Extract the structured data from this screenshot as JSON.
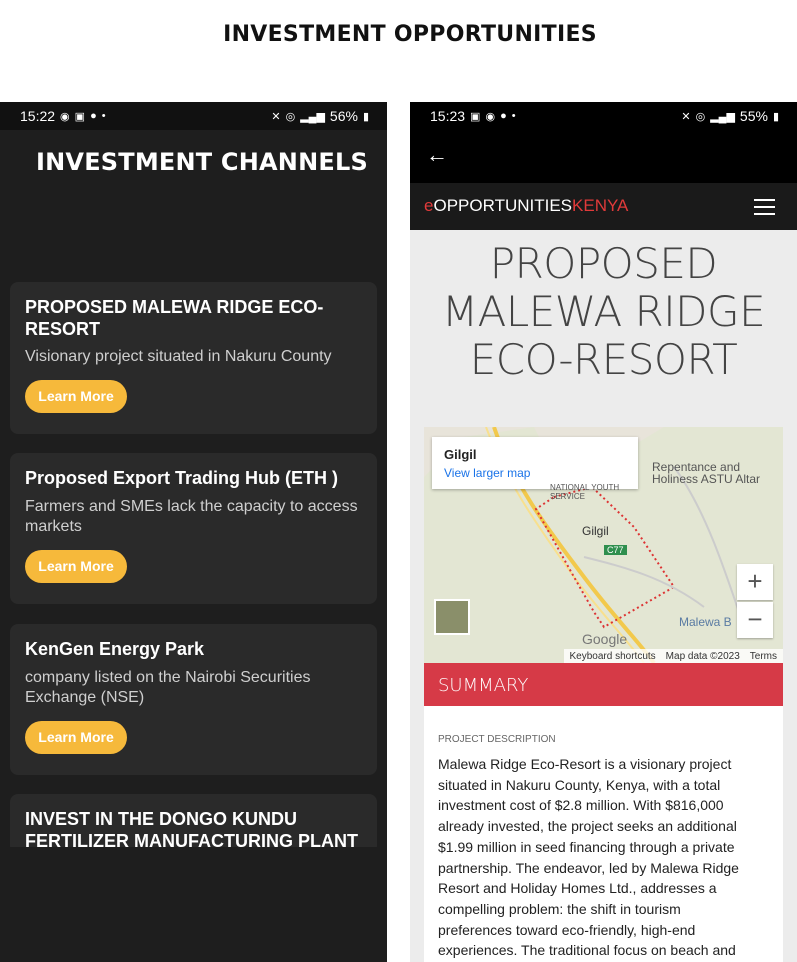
{
  "heading": "INVESTMENT OPPORTUNITIES",
  "left_phone": {
    "status": {
      "time": "15:22",
      "battery": "56%"
    },
    "title": "INVESTMENT CHANNELS",
    "cards": [
      {
        "title": "PROPOSED MALEWA RIDGE ECO-RESORT",
        "desc": "Visionary project situated in Nakuru County",
        "button": "Learn More"
      },
      {
        "title": "Proposed Export Trading Hub (ETH )",
        "desc": "Farmers and SMEs lack the capacity to access markets",
        "button": "Learn More"
      },
      {
        "title": "KenGen Energy Park",
        "desc": "company listed on the Nairobi Securities Exchange (NSE)",
        "button": "Learn More"
      },
      {
        "title": "INVEST IN THE DONGO KUNDU FERTILIZER MANUFACTURING PLANT"
      }
    ]
  },
  "right_phone": {
    "status": {
      "time": "15:23",
      "battery": "55%"
    },
    "brand": {
      "e": "e",
      "opp": "OPPORTUNITIES",
      "kenya": "KENYA"
    },
    "page_title": "PROPOSED MALEWA RIDGE ECO-RESORT",
    "map": {
      "place": "Gilgil",
      "link": "View larger map",
      "labels": {
        "repentance": "Repentance and Holiness ASTU Altar",
        "gilgil": "Gilgil",
        "road": "C77",
        "nys": "NATIONAL YOUTH SERVICE",
        "malewa": "Malewa B",
        "google": "Google"
      },
      "footer": {
        "shortcuts": "Keyboard shortcuts",
        "data": "Map data ©2023",
        "terms": "Terms"
      }
    },
    "summary": "SUMMARY",
    "desc_label": "PROJECT DESCRIPTION",
    "desc_text": "Malewa Ridge Eco-Resort is a visionary project situated in Nakuru County, Kenya, with a total investment cost of $2.8 million. With $816,000 already invested, the project seeks an additional $1.99 million in seed financing through a private partnership. The endeavor, led by Malewa Ridge Resort and Holiday Homes Ltd., addresses a compelling problem: the shift in tourism preferences toward eco-friendly, high-end experiences. The traditional focus on beach and"
  }
}
